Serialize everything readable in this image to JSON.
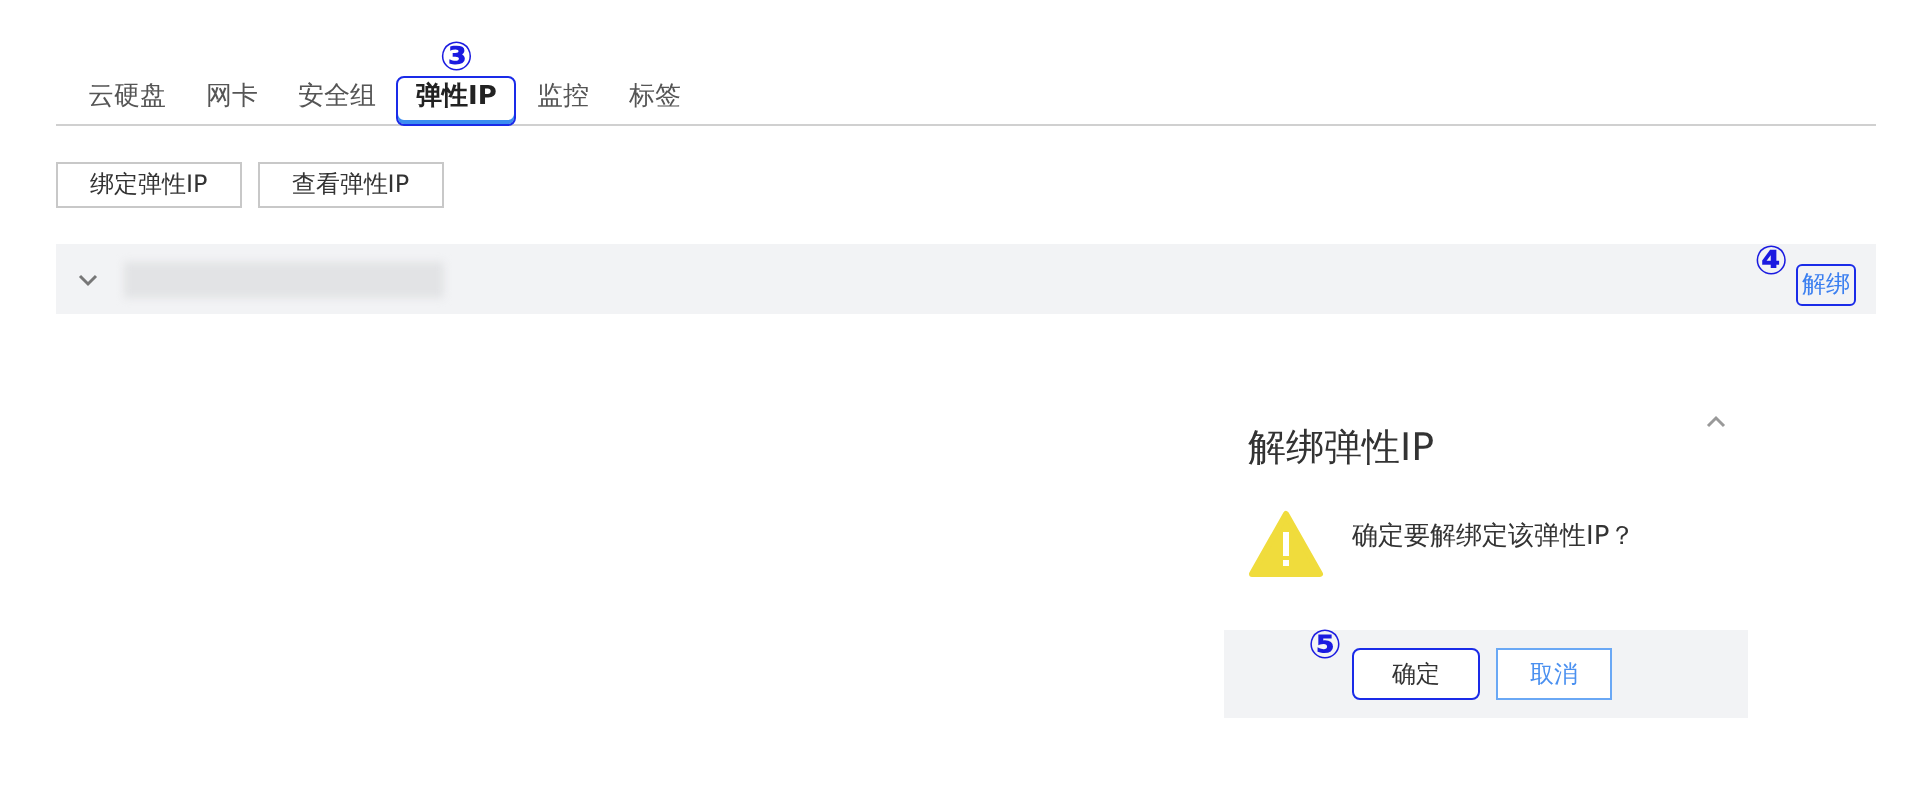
{
  "tabs": [
    {
      "label": "云硬盘",
      "selected": false
    },
    {
      "label": "网卡",
      "selected": false
    },
    {
      "label": "安全组",
      "selected": false
    },
    {
      "label": "弹性IP",
      "selected": true,
      "marker": "③"
    },
    {
      "label": "监控",
      "selected": false
    },
    {
      "label": "标签",
      "selected": false
    }
  ],
  "toolbar": {
    "buttons": [
      "绑定弹性IP",
      "查看弹性IP"
    ]
  },
  "row": {
    "expanded": false,
    "action": {
      "label": "解绑",
      "marker": "④"
    }
  },
  "dialog": {
    "title": "解绑弹性IP",
    "message": "确定要解绑定该弹性IP？",
    "confirm": {
      "label": "确定",
      "marker": "⑤"
    },
    "cancel": "取消"
  }
}
